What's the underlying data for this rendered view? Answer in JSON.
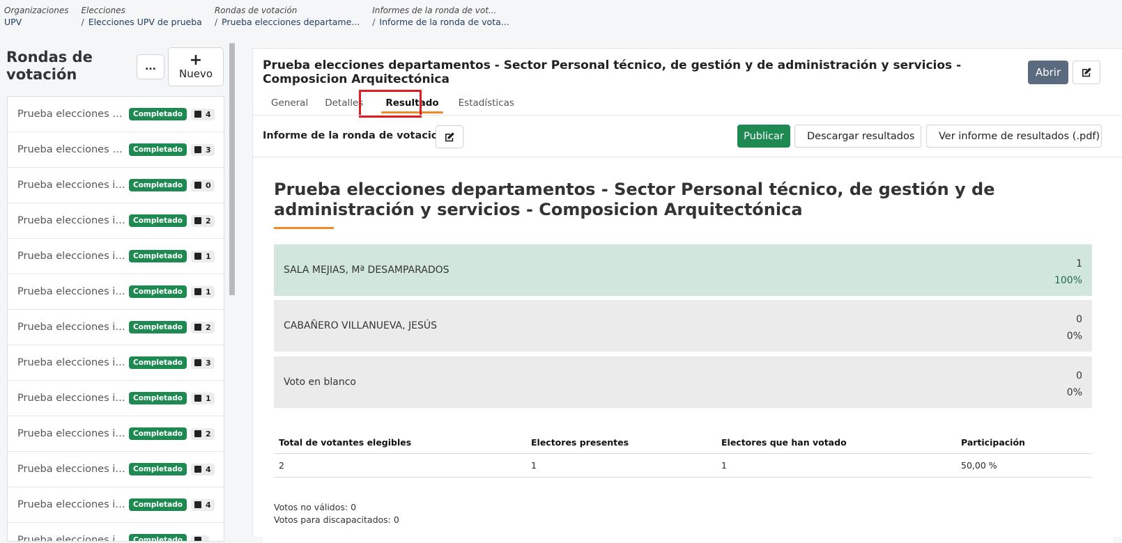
{
  "breadcrumb": [
    {
      "label": "Organizaciones",
      "value": "UPV"
    },
    {
      "label": "Elecciones",
      "value": "Elecciones UPV de prueba"
    },
    {
      "label": "Rondas de votación",
      "value": "Prueba elecciones departame..."
    },
    {
      "label": "Informes de la ronda de vot...",
      "value": "Informe de la ronda de vota..."
    }
  ],
  "sidebar": {
    "title": "Rondas de votación",
    "more_label": "...",
    "new_label": "Nuevo",
    "new_icon": "+",
    "items": [
      {
        "name": "Prueba elecciones de...",
        "status": "Completado",
        "count": "4"
      },
      {
        "name": "Prueba elecciones de...",
        "status": "Completado",
        "count": "3"
      },
      {
        "name": "Prueba elecciones ins...",
        "status": "Completado",
        "count": "0"
      },
      {
        "name": "Prueba elecciones ins...",
        "status": "Completado",
        "count": "2"
      },
      {
        "name": "Prueba elecciones ins...",
        "status": "Completado",
        "count": "1"
      },
      {
        "name": "Prueba elecciones ins...",
        "status": "Completado",
        "count": "1"
      },
      {
        "name": "Prueba elecciones ins...",
        "status": "Completado",
        "count": "2"
      },
      {
        "name": "Prueba elecciones ins...",
        "status": "Completado",
        "count": "3"
      },
      {
        "name": "Prueba elecciones ins...",
        "status": "Completado",
        "count": "1"
      },
      {
        "name": "Prueba elecciones ins...",
        "status": "Completado",
        "count": "2"
      },
      {
        "name": "Prueba elecciones ins...",
        "status": "Completado",
        "count": "4"
      },
      {
        "name": "Prueba elecciones ins...",
        "status": "Completado",
        "count": "4"
      },
      {
        "name": "Prueba elecciones ins...",
        "status": "Completado",
        "count": ""
      }
    ]
  },
  "main": {
    "title": "Prueba elecciones departamentos - Sector Personal técnico, de gestión y de administración y servicios - Composicion Arquitectónica",
    "open_label": "Abrir",
    "tabs": [
      {
        "label": "General"
      },
      {
        "label": "Detalles"
      },
      {
        "label": "Resultado"
      },
      {
        "label": "Estadísticas"
      }
    ],
    "subheader": {
      "title": "Informe de la ronda de votaciones",
      "publish_label": "Publicar",
      "download_label": "Descargar resultados",
      "view_pdf_label": "Ver informe de resultados (.pdf)"
    }
  },
  "report": {
    "title": "Prueba elecciones departamentos - Sector Personal técnico, de gestión y de administración y servicios - Composicion Arquitectónica",
    "candidates": [
      {
        "name": "SALA MEJIAS, Mª DESAMPARADOS",
        "votes": "1",
        "percent": "100%"
      },
      {
        "name": "CABAÑERO VILLANUEVA, JESÚS",
        "votes": "0",
        "percent": "0%"
      },
      {
        "name": "Voto en blanco",
        "votes": "0",
        "percent": "0%"
      }
    ],
    "stats_headers": [
      "Total de votantes elegibles",
      "Electores presentes",
      "Electores que han votado",
      "Participación"
    ],
    "stats_values": [
      "2",
      "1",
      "1",
      "50,00 %"
    ],
    "invalid_votes": "Votos no válidos: 0",
    "disabled_votes": "Votos para discapacitados: 0"
  },
  "colors": {
    "accent": "#f08a24",
    "success": "#1e8a52",
    "open_button": "#5a6b80",
    "winner_bg": "#d1e7dd",
    "highlight": "#e01b22"
  }
}
